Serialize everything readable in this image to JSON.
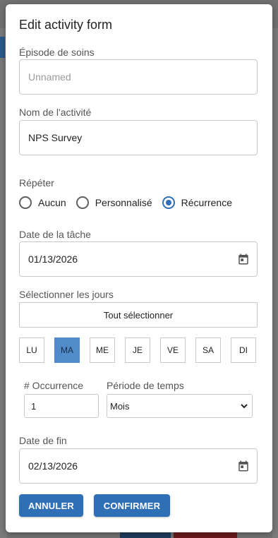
{
  "dialog": {
    "title": "Edit activity form"
  },
  "episode": {
    "label": "Épisode de soins",
    "placeholder": "Unnamed",
    "value": ""
  },
  "activity_name": {
    "label": "Nom de l'activité",
    "value": "NPS Survey"
  },
  "repeat": {
    "label": "Répéter",
    "options": [
      {
        "label": "Aucun",
        "checked": false
      },
      {
        "label": "Personnalisé",
        "checked": false
      },
      {
        "label": "Récurrence",
        "checked": true
      }
    ]
  },
  "task_date": {
    "label": "Date de la tâche",
    "value": "01/13/2026",
    "icon": "calendar-icon"
  },
  "days": {
    "label": "Sélectionner les jours",
    "select_all": "Tout sélectionner",
    "items": [
      {
        "label": "LU",
        "selected": false
      },
      {
        "label": "MA",
        "selected": true
      },
      {
        "label": "ME",
        "selected": false
      },
      {
        "label": "JE",
        "selected": false
      },
      {
        "label": "VE",
        "selected": false
      },
      {
        "label": "SA",
        "selected": false
      },
      {
        "label": "DI",
        "selected": false
      }
    ]
  },
  "occurrence": {
    "label": "# Occurrence",
    "value": "1"
  },
  "period": {
    "label": "Période de temps",
    "selected": "Mois"
  },
  "end_date": {
    "label": "Date de fin",
    "value": "02/13/2026",
    "icon": "calendar-icon"
  },
  "actions": {
    "cancel": "ANNULER",
    "confirm": "CONFIRMER"
  },
  "colors": {
    "primary": "#2f6fb5",
    "selected_day": "#4f8cc9"
  }
}
